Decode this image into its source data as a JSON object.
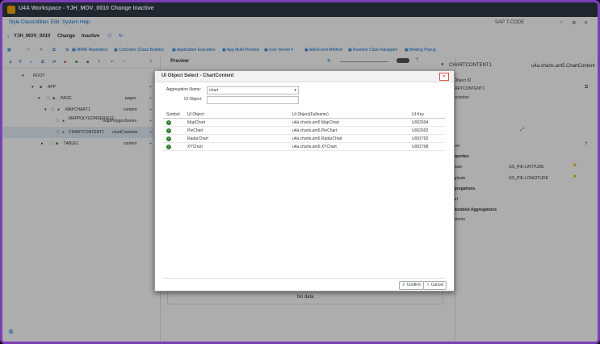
{
  "window": {
    "title": "U4A Workspace - YJH_MOV_0010 Change Inactive"
  },
  "menu": [
    "Style Class",
    "Utilities",
    "Edit",
    "System",
    "Help"
  ],
  "status_right": {
    "sapt": "SAP T-CODE"
  },
  "header": {
    "app_id": "YJH_MOV_0010",
    "mode": "Change",
    "state": "Inactive"
  },
  "toolbar": {
    "items": [
      "MIME Repository",
      "Controller (Class Builder)",
      "Application Execution",
      "App Multi Preview",
      "Icon Viewer",
      "Add Event Method",
      "Runtime Class Navigator",
      "Binding Popup"
    ]
  },
  "tree": [
    {
      "label": "ROOT"
    },
    {
      "label": "APP"
    },
    {
      "label": "PAGE",
      "agg": "pages"
    },
    {
      "label": "MAPCHART1",
      "agg": "content"
    },
    {
      "label": "MAPPOLYGONSERIES1",
      "agg": "mapPolygonSeries"
    },
    {
      "label": "CHARTCONTENT1",
      "agg": "chartContents"
    },
    {
      "label": "TABLE1",
      "agg": "content"
    }
  ],
  "preview": {
    "title": "Preview",
    "no_data": "No data"
  },
  "right": {
    "title": "CHARTCONTENT1",
    "class": "u4a.charts.am5.ChartContent",
    "ui_id_label": "UI Object ID",
    "ui_id_value": "CHARTCONTENT1",
    "desc_label": "Description",
    "reset": "Reset",
    "properties": "Properties",
    "props": [
      {
        "name": "latitude",
        "value": "GS_PIE-LATITUDE"
      },
      {
        "name": "longitude",
        "value": "GS_PIE-LONGITUDE"
      }
    ],
    "aggregations": "Aggregations",
    "agg_item": "chart",
    "embedded": "Embedded Aggregations",
    "emb_item": "Contents"
  },
  "dialog": {
    "title": "UI Object Select - ChartContent",
    "agg_label": "Aggregation Name:",
    "agg_value": "chart",
    "obj_label": "UI Object:",
    "obj_value": "",
    "columns": [
      "Symbol",
      "UI Object",
      "UI Object(Fullname)",
      "UI Key"
    ],
    "rows": [
      {
        "obj": "MapChart",
        "full": "u4a.charts.am5.MapChart",
        "key": "U002694"
      },
      {
        "obj": "PieChart",
        "full": "u4a.charts.am5.PieChart",
        "key": "U002692"
      },
      {
        "obj": "RadarChart",
        "full": "u4a.charts.am5.RadarChart",
        "key": "U002702"
      },
      {
        "obj": "XYChart",
        "full": "u4a.charts.am5.XYChart",
        "key": "U002708"
      }
    ],
    "confirm": "Confirm",
    "cancel": "Cancel"
  }
}
